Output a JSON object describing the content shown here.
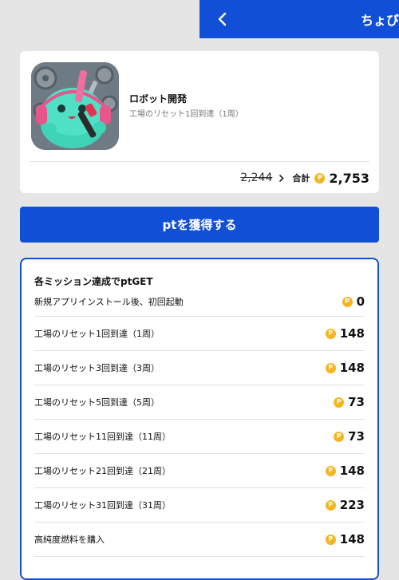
{
  "header": {
    "title": "ちょび"
  },
  "app": {
    "name": "ロボット開発",
    "subtitle": "工場のリセット1回到達（1周）",
    "old_points": "2,244",
    "total_label": "合計",
    "total_points": "2,753"
  },
  "cta": {
    "label": "ptを獲得する"
  },
  "missions": {
    "heading": "各ミッション達成でptGET",
    "items": [
      {
        "label": "新規アプリインストール後、初回起動",
        "points": "0"
      },
      {
        "label": "工場のリセット1回到達（1周）",
        "points": "148"
      },
      {
        "label": "工場のリセット3回到達（3周）",
        "points": "148"
      },
      {
        "label": "工場のリセット5回到達（5周）",
        "points": "73"
      },
      {
        "label": "工場のリセット11回到達（11周）",
        "points": "73"
      },
      {
        "label": "工場のリセット21回到達（21周）",
        "points": "148"
      },
      {
        "label": "工場のリセット31回到達（31周）",
        "points": "223"
      },
      {
        "label": "高純度燃料を購入",
        "points": "148"
      }
    ]
  },
  "icons": {
    "back": "chevron-left-icon",
    "arrow": "chevron-right-icon",
    "coin": "point-coin-icon"
  },
  "colors": {
    "brand_blue": "#1150d6",
    "coin_gold": "#f4b521",
    "background": "#e5e5e5"
  }
}
